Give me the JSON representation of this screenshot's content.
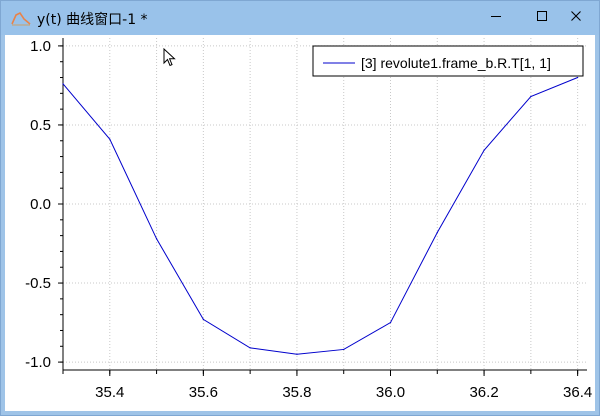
{
  "window": {
    "title": "y(t) 曲线窗口-1 *",
    "icons": {
      "app": "line-chart-icon",
      "minimize": "minimize-icon",
      "maximize": "maximize-icon",
      "close": "close-icon"
    }
  },
  "colors": {
    "titlebar": "#99c2ea",
    "series": "#0000cc",
    "grid": "#c8c8c8"
  },
  "chart_data": {
    "type": "line",
    "legend_position": "top-right",
    "grid": true,
    "xlim": [
      35.3,
      36.42
    ],
    "ylim": [
      -1.05,
      1.05
    ],
    "xticks": [
      35.4,
      35.6,
      35.8,
      36.0,
      36.2,
      36.4
    ],
    "xtick_labels": [
      "35.4",
      "35.6",
      "35.8",
      "36.0",
      "36.2",
      "36.4"
    ],
    "yticks": [
      1.0,
      0.5,
      0.0,
      -0.5,
      -1.0
    ],
    "ytick_labels": [
      "1.0",
      "0.5",
      "0.0",
      "-0.5",
      "-1.0"
    ],
    "series": [
      {
        "name": "[3] revolute1.frame_b.R.T[1, 1]",
        "color": "#0000cc",
        "x": [
          35.3,
          35.4,
          35.5,
          35.6,
          35.7,
          35.8,
          35.9,
          36.0,
          36.1,
          36.2,
          36.3,
          36.4
        ],
        "y": [
          0.76,
          0.41,
          -0.22,
          -0.73,
          -0.91,
          -0.95,
          -0.92,
          -0.75,
          -0.18,
          0.34,
          0.68,
          0.8
        ]
      }
    ]
  }
}
